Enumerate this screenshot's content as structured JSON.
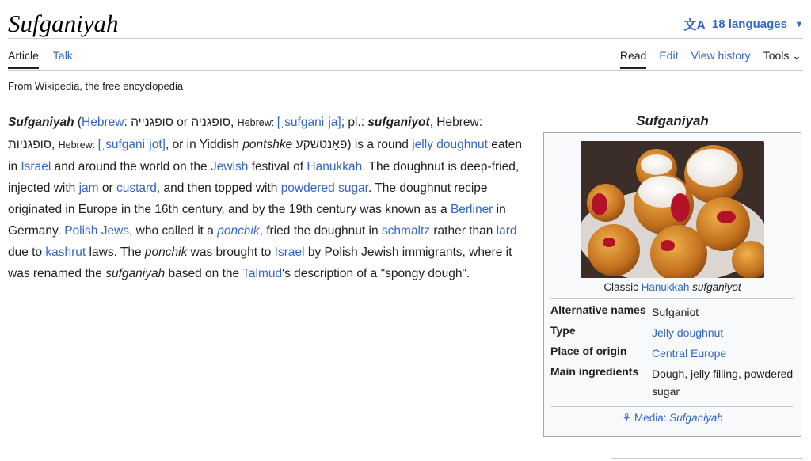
{
  "header": {
    "title": "Sufganiyah",
    "languages": "18 languages"
  },
  "tabs": {
    "article": "Article",
    "talk": "Talk",
    "read": "Read",
    "edit": "Edit",
    "history": "View history",
    "tools": "Tools"
  },
  "tagline": "From Wikipedia, the free encyclopedia",
  "lead": {
    "w1": "Sufganiyah",
    "w2": " (",
    "w3": "Hebrew",
    "w4": ": סופגנייה or סופגניה, ",
    "w5": "Hebrew: ",
    "w6": "[ˌsufɡaniˈja]",
    "w7": "; ",
    "w8": "pl.",
    "w9": ": ",
    "w10": "sufganiyot",
    "w11": ", Hebrew: סופגניות, ",
    "w12": "Hebrew: ",
    "w13": "[ˌsufɡaniˈjot]",
    "w14": ", or in Yiddish ",
    "w15": "pontshke",
    "w16": " פּאָנטשקע) is a round ",
    "w17": "jelly doughnut",
    "w18": " eaten in ",
    "w19": "Israel",
    "w20": " and around the world on the ",
    "w21": "Jewish",
    "w22": " festival of ",
    "w23": "Hanukkah",
    "w24": ". The doughnut is deep-fried, injected with ",
    "w25": "jam",
    "w26": " or ",
    "w27": "custard",
    "w28": ", and then topped with ",
    "w29": "powdered sugar",
    "w30": ". The doughnut recipe originated in Europe in the 16th century, and by the 19th century was known as a ",
    "w31": "Berliner",
    "w32": " in Germany. ",
    "w33": "Polish Jews",
    "w34": ", who called it a ",
    "w35": "ponchik",
    "w36": ", fried the doughnut in ",
    "w37": "schmaltz",
    "w38": " rather than ",
    "w39": "lard",
    "w40": " due to ",
    "w41": "kashrut",
    "w42": " laws. The ",
    "w43": "ponchik",
    "w44": " was brought to ",
    "w45": "Israel",
    "w46": " by Polish Jewish immigrants, where it was renamed the ",
    "w47": "sufganiyah",
    "w48": " based on the ",
    "w49": "Talmud",
    "w50": "'s description of a \"spongy dough\"."
  },
  "infobox": {
    "title": "Sufganiyah",
    "caption_pre": "Classic ",
    "caption_link": "Hanukkah",
    "caption_post": " sufganiyot",
    "rows": [
      {
        "label": "Alternative names",
        "value": "Sufganiot"
      },
      {
        "label": "Type",
        "value": "Jelly doughnut"
      },
      {
        "label": "Place of origin",
        "value": "Central Europe"
      },
      {
        "label": "Main ingredients",
        "value": "Dough, jelly filling, powdered sugar"
      }
    ],
    "media_prefix": "Media: ",
    "media_link": "Sufganiyah"
  }
}
